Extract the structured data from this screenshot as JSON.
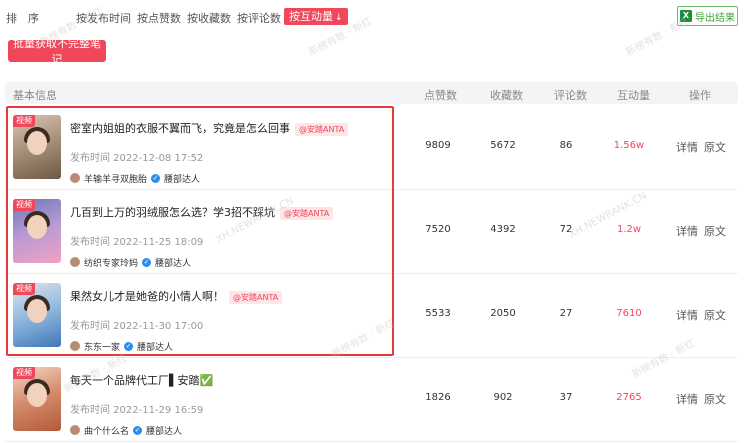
{
  "sortbar": {
    "label": "排　序",
    "items": [
      "按发布时间",
      "按点赞数",
      "按收藏数",
      "按评论数",
      "按互动量"
    ],
    "active_index": 4,
    "active_arrow": "↓"
  },
  "toolbar": {
    "export_label": "导出结果",
    "export_icon": "excel-icon",
    "batch_label": "批量获取不完整笔记"
  },
  "table": {
    "headers": [
      "基本信息",
      "点赞数",
      "收藏数",
      "评论数",
      "互动量",
      "操作"
    ],
    "rows": [
      {
        "tag": "视频",
        "title": "密室内姐姐的衣服不翼而飞，究竟是怎么回事",
        "mention": "@安踏ANTA",
        "pubtime": "发布时间 2022-12-08 17:52",
        "author": "羊输羊寻双胞胎",
        "level": "腰部达人",
        "likes": "9809",
        "collects": "5672",
        "comments": "86",
        "interactions": "1.56w",
        "detail": "详情",
        "origin": "原文"
      },
      {
        "tag": "视频",
        "title": "几百到上万的羽绒服怎么选？学3招不踩坑",
        "mention": "@安踏ANTA",
        "pubtime": "发布时间 2022-11-25 18:09",
        "author": "纺织专家玲妈",
        "level": "腰部达人",
        "likes": "7520",
        "collects": "4392",
        "comments": "72",
        "interactions": "1.2w",
        "detail": "详情",
        "origin": "原文"
      },
      {
        "tag": "视频",
        "title": "果然女儿才是她爸的小情人啊！",
        "mention": "@安踏ANTA",
        "pubtime": "发布时间 2022-11-30 17:00",
        "author": "东东一家",
        "level": "腰部达人",
        "likes": "5533",
        "collects": "2050",
        "comments": "27",
        "interactions": "7610",
        "detail": "详情",
        "origin": "原文"
      },
      {
        "tag": "视频",
        "title": "每天一个品牌代工厂▌安踏✅",
        "mention": "",
        "pubtime": "发布时间 2022-11-29 16:59",
        "author": "曲个什么名",
        "level": "腰部达人",
        "likes": "1826",
        "collects": "902",
        "comments": "37",
        "interactions": "2765",
        "detail": "详情",
        "origin": "原文"
      }
    ]
  },
  "watermark": "新榜有数 · 新红",
  "watermark2": "XH.NEWRANK.CN",
  "colors": {
    "accent": "#f0475a",
    "export_green": "#3fa53f",
    "highlight": "#e53b3b"
  }
}
